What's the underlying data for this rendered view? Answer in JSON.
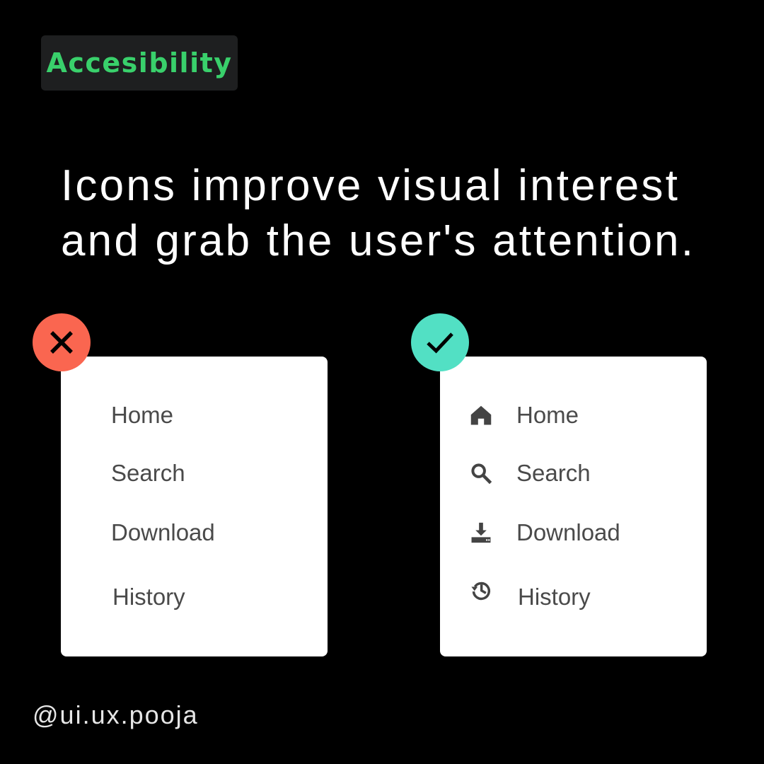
{
  "tag": {
    "label": "Accesibility",
    "color": "#39d06b"
  },
  "headline": {
    "line1": "Icons improve visual interest",
    "line2": "and grab the user's attention."
  },
  "bad_example": {
    "badge_icon": "close-icon",
    "badge_color": "#fa6650",
    "items": [
      {
        "label": "Home"
      },
      {
        "label": "Search"
      },
      {
        "label": "Download"
      },
      {
        "label": "History"
      }
    ]
  },
  "good_example": {
    "badge_icon": "check-icon",
    "badge_color": "#52e0c4",
    "items": [
      {
        "label": "Home",
        "icon": "home-icon"
      },
      {
        "label": "Search",
        "icon": "search-icon"
      },
      {
        "label": "Download",
        "icon": "download-icon"
      },
      {
        "label": "History",
        "icon": "history-icon"
      }
    ]
  },
  "footer": {
    "handle": "@ui.ux.pooja"
  }
}
